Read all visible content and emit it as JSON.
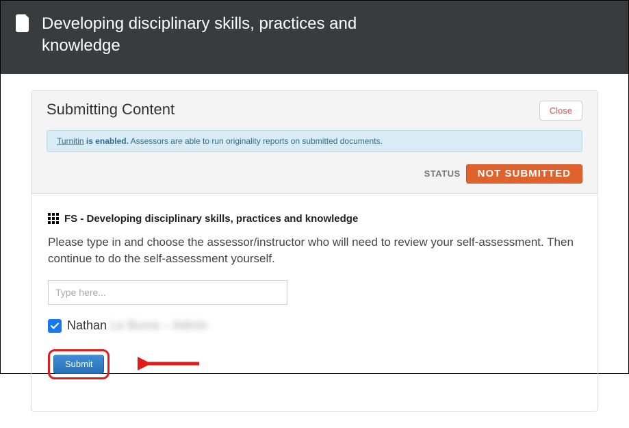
{
  "header": {
    "title": "Developing disciplinary skills, practices and knowledge"
  },
  "panel": {
    "title": "Submitting Content",
    "close_label": "Close",
    "info_link": "Turnitin",
    "info_strong": " is enabled.",
    "info_rest": " Assessors are able to run originality reports on submitted documents.",
    "status_label": "STATUS",
    "status_value": "NOT SUBMITTED"
  },
  "section": {
    "prefix": "FS - ",
    "title": "Developing disciplinary skills, practices and knowledge",
    "instructions": "Please type in and choose the assessor/instructor who will need to review your self-assessment. Then continue to do the self-assessment yourself."
  },
  "form": {
    "placeholder": "Type here...",
    "assessor_checked": true,
    "assessor_first": "Nathan",
    "assessor_rest_blurred": "Le Burns – Admin",
    "submit_label": "Submit"
  }
}
